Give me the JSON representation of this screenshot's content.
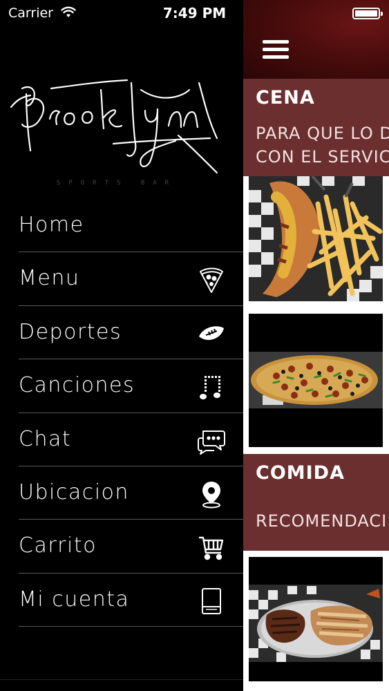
{
  "status_bar": {
    "carrier": "Carrier",
    "time": "7:49 PM"
  },
  "drawer": {
    "logo_text": "Brooklyn",
    "logo_subtitle": "SPORTS BAR",
    "items": [
      {
        "label": "Home",
        "icon": null
      },
      {
        "label": "Menu",
        "icon": "pizza-icon"
      },
      {
        "label": "Deportes",
        "icon": "football-icon"
      },
      {
        "label": "Canciones",
        "icon": "music-note-icon"
      },
      {
        "label": "Chat",
        "icon": "chat-bubbles-icon"
      },
      {
        "label": "Ubicacion",
        "icon": "location-pin-icon"
      },
      {
        "label": "Carrito",
        "icon": "shopping-cart-icon"
      },
      {
        "label": "Mi cuenta",
        "icon": "account-book-icon"
      }
    ]
  },
  "main": {
    "sections": [
      {
        "title": "CENA",
        "desc_line1": "PARA QUE LO D",
        "desc_line2": "CON EL SERVIC",
        "cards": [
          "hotdog-fries-photo",
          "pizza-photo"
        ]
      },
      {
        "title": "COMIDA",
        "desc_line1": "RECOMENDACI",
        "cards": [
          "steak-chicken-photo"
        ]
      }
    ]
  },
  "colors": {
    "drawer_bg": "#000000",
    "section_bg": "#6b2f2f",
    "topbar_bg": "#4a0c0c",
    "divider": "#5a5a5a",
    "text": "#ffffff"
  }
}
